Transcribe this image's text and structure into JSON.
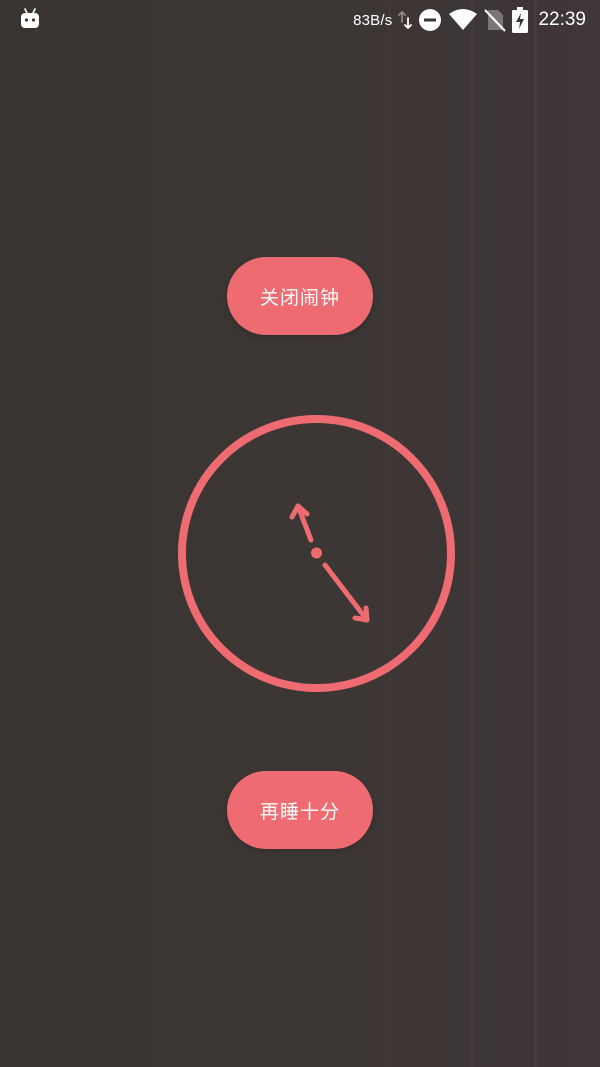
{
  "status_bar": {
    "app_icon": "android-robot-icon",
    "net_speed": "83B/s",
    "icons": [
      "data-transfer-icon",
      "do-not-disturb-icon",
      "wifi-icon",
      "no-sim-icon",
      "battery-charging-icon"
    ],
    "time": "22:39"
  },
  "alarm": {
    "dismiss_label": "关闭闹钟",
    "snooze_label": "再睡十分"
  },
  "clock": {
    "hour_hand": "hour-hand",
    "minute_hand": "minute-hand"
  },
  "colors": {
    "accent": "#ef6b72",
    "background": "#3b3533",
    "status_text": "#ffffff"
  }
}
